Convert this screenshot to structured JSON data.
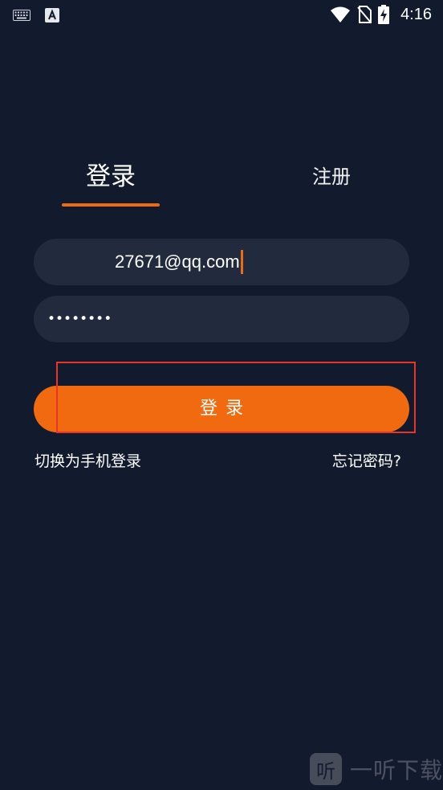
{
  "status_bar": {
    "time": "4:16",
    "left_icons": [
      "keyboard-icon",
      "a-letter-icon"
    ],
    "right_icons": [
      "wifi-icon",
      "no-sim-icon",
      "battery-charging-icon"
    ]
  },
  "tabs": {
    "login_label": "登录",
    "register_label": "注册",
    "active": "login"
  },
  "form": {
    "email_value": "27671@qq.com",
    "password_value": "••••••••"
  },
  "login_button": {
    "label": "登录"
  },
  "links": {
    "switch_to_phone": "切换为手机登录",
    "forgot_password": "忘记密码?"
  },
  "watermark": {
    "logo_glyph": "听",
    "text": "一听下载"
  },
  "colors": {
    "background": "#121a2e",
    "field_background": "#222b3e",
    "accent": "#f26a0f",
    "highlight_border": "#e8352c",
    "text": "#ffffff"
  }
}
